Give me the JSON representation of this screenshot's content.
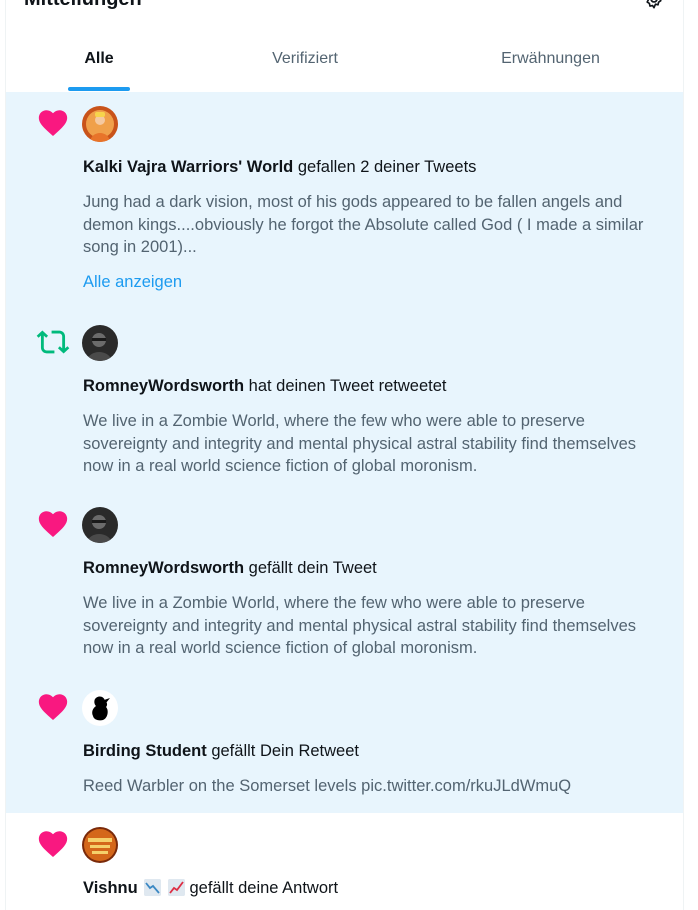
{
  "header": {
    "title": "Mitteilungen",
    "settings_icon": "gear-icon"
  },
  "tabs": [
    {
      "label": "Alle",
      "active": true
    },
    {
      "label": "Verifiziert",
      "active": false
    },
    {
      "label": "Erwähnungen",
      "active": false
    }
  ],
  "colors": {
    "accent": "#1d9bf0",
    "like": "#f91880",
    "retweet": "#00ba7c",
    "unread_bg": "#e8f5fd"
  },
  "notifications": [
    {
      "kind": "like",
      "kind_icon": "heart-icon",
      "actor": "Kalki Vajra Warriors' World",
      "action": "gefallen 2 deiner Tweets",
      "text": "Jung had a dark vision, most of his gods appeared to be fallen angels and demon kings....obviously he forgot the Absolute called God ( I made a similar song in 2001)...",
      "link": "Alle anzeigen"
    },
    {
      "kind": "retweet",
      "kind_icon": "retweet-icon",
      "actor": "RomneyWordsworth",
      "action": "hat deinen Tweet retweetet",
      "text": "We live in a Zombie World, where the few who were able to preserve sovereignty and integrity and mental physical astral stability find themselves now in a real world science fiction of global moronism."
    },
    {
      "kind": "like",
      "kind_icon": "heart-icon",
      "actor": "RomneyWordsworth",
      "action": "gefällt dein Tweet",
      "text": "We live in a Zombie World, where the few who were able to preserve sovereignty and integrity and mental physical astral stability find themselves now in a real world science fiction of global moronism."
    },
    {
      "kind": "like",
      "kind_icon": "heart-icon",
      "actor": "Birding Student",
      "action": "gefällt Dein Retweet",
      "text": "Reed Warbler on the Somerset levels pic.twitter.com/rkuJLdWmuQ"
    },
    {
      "kind": "like",
      "kind_icon": "heart-icon",
      "actor": "Vishnu",
      "actor_emojis": [
        "chart-decreasing-emoji",
        "chart-increasing-emoji"
      ],
      "action": "gefällt deine Antwort"
    }
  ]
}
